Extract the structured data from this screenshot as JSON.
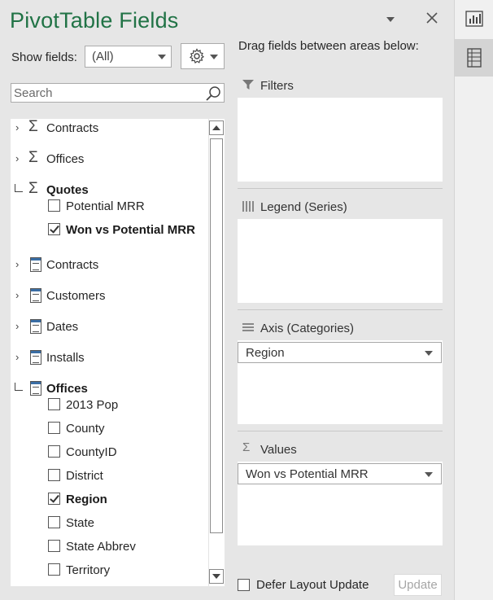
{
  "panel": {
    "title": "PivotTable Fields",
    "show_fields_label": "Show fields:",
    "show_fields_value": "(All)",
    "search_placeholder": "Search",
    "drag_instruction": "Drag fields between areas below:",
    "accent_color": "#217346"
  },
  "fields": [
    {
      "label": "Contracts",
      "kind": "measure-group",
      "expanded": false
    },
    {
      "label": "Offices",
      "kind": "measure-group",
      "expanded": false
    },
    {
      "label": "Quotes",
      "kind": "measure-group",
      "expanded": true,
      "bold": true
    },
    {
      "label": "Potential MRR",
      "kind": "field",
      "checked": false
    },
    {
      "label": "Won vs Potential MRR",
      "kind": "field",
      "checked": true,
      "bold": true
    },
    {
      "label": "Contracts",
      "kind": "table",
      "expanded": false
    },
    {
      "label": "Customers",
      "kind": "table",
      "expanded": false
    },
    {
      "label": "Dates",
      "kind": "table",
      "expanded": false
    },
    {
      "label": "Installs",
      "kind": "table",
      "expanded": false
    },
    {
      "label": "Offices",
      "kind": "table",
      "expanded": true,
      "bold": true
    },
    {
      "label": "2013 Pop",
      "kind": "field",
      "checked": false
    },
    {
      "label": "County",
      "kind": "field",
      "checked": false
    },
    {
      "label": "CountyID",
      "kind": "field",
      "checked": false
    },
    {
      "label": "District",
      "kind": "field",
      "checked": false
    },
    {
      "label": "Region",
      "kind": "field",
      "checked": true,
      "bold": true
    },
    {
      "label": "State",
      "kind": "field",
      "checked": false
    },
    {
      "label": "State Abbrev",
      "kind": "field",
      "checked": false
    },
    {
      "label": "Territory",
      "kind": "field",
      "checked": false
    }
  ],
  "areas": {
    "filters": {
      "label": "Filters",
      "icon": "filter-icon"
    },
    "legend": {
      "label": "Legend (Series)",
      "icon": "columns-icon"
    },
    "axis": {
      "label": "Axis (Categories)",
      "icon": "rows-icon",
      "field": "Region"
    },
    "values": {
      "label": "Values",
      "icon": "sigma-icon",
      "field": "Won vs Potential MRR"
    }
  },
  "footer": {
    "defer_label": "Defer Layout Update",
    "update_label": "Update"
  },
  "side_strip": [
    {
      "name": "chart-format-icon",
      "active": false
    },
    {
      "name": "field-list-icon",
      "active": true
    }
  ]
}
